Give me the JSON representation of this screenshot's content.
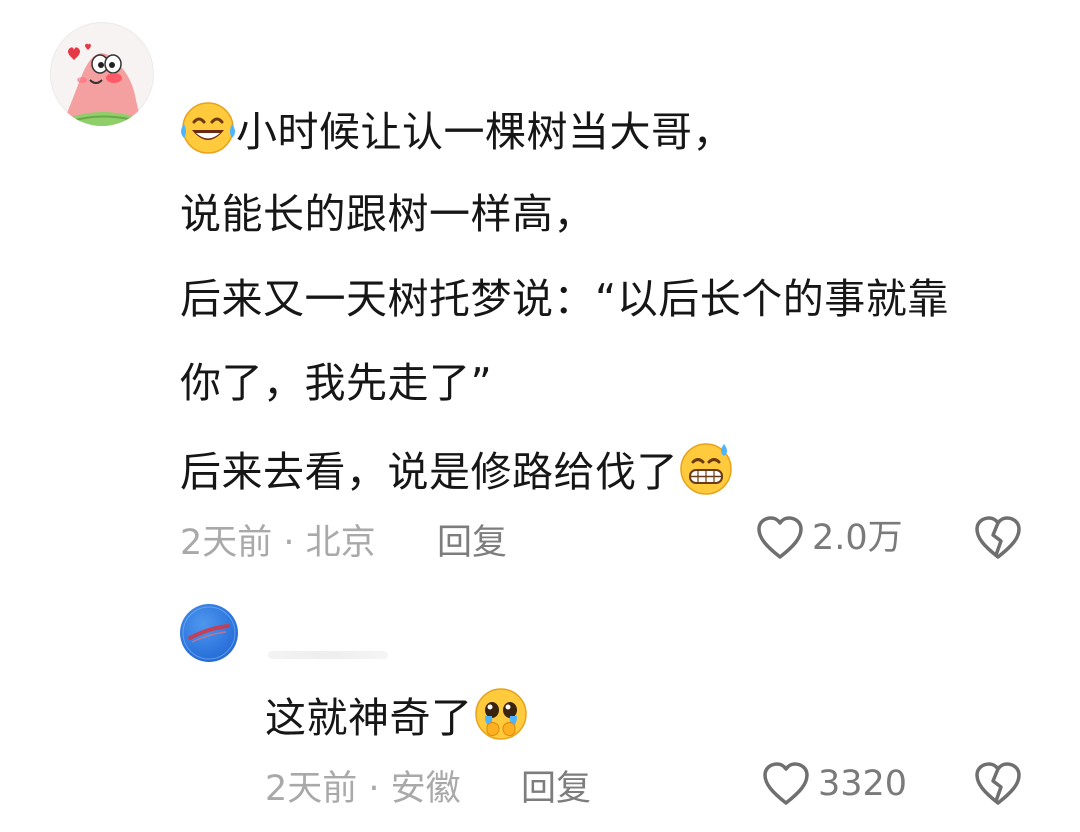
{
  "comment": {
    "avatar_icon": "patrick-star-avatar-icon",
    "lines": [
      "小时候让认一棵树当大哥，",
      "说能长的跟树一样高，",
      "后来又一天树托梦说：“以后长个的事就靠",
      "你了，我先走了”",
      "后来去看，说是修路给伐了"
    ],
    "lead_emoji": "laughing-tears-emoji",
    "trail_emoji": "grinning-sweat-emoji",
    "meta": "2天前 · 北京",
    "reply_label": "回复",
    "likes": "2.0万",
    "like_icon": "heart-outline-icon",
    "dislike_icon": "broken-heart-icon"
  },
  "reply": {
    "avatar_icon": "blue-circle-avatar-icon",
    "text": "这就神奇了",
    "trail_emoji": "pleading-teary-emoji",
    "meta": "2天前 · 安徽",
    "reply_label": "回复",
    "likes": "3320",
    "like_icon": "heart-outline-icon",
    "dislike_icon": "broken-heart-icon"
  },
  "colors": {
    "text": "#161616",
    "meta": "#a9a9a9",
    "action": "#7d7d7d"
  }
}
